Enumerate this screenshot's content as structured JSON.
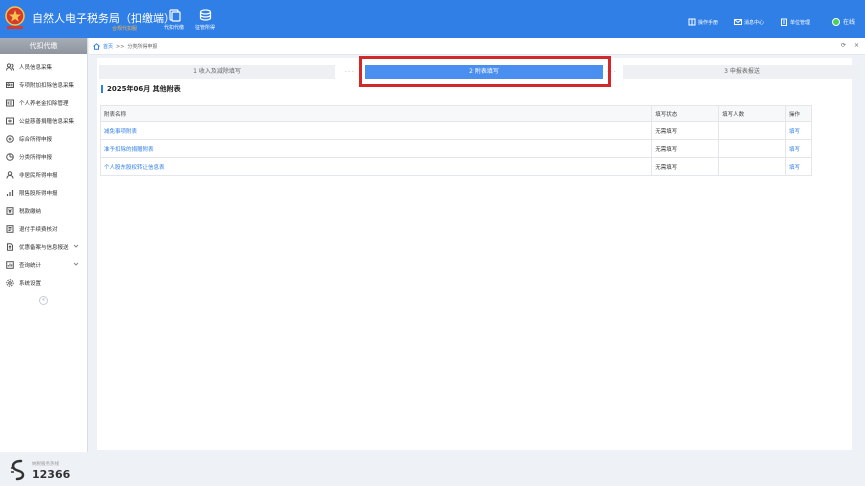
{
  "app": {
    "title": "自然人电子税务局（扣缴端）",
    "subtitle": "合规代扣服",
    "logo": "tax-emblem-logo"
  },
  "top_nav": [
    {
      "label": "代扣代缴",
      "icon": "document-stack-icon"
    },
    {
      "label": "征管所得",
      "icon": "coin-stack-icon"
    }
  ],
  "top_right": {
    "manual": "操作手册",
    "messages": "消息中心",
    "unit_manage": "单位管理",
    "online": "在线"
  },
  "sidebar": {
    "header": "代扣代缴",
    "items": [
      {
        "label": "人员信息采集",
        "icon": "people-icon"
      },
      {
        "label": "专项附加扣除信息采集",
        "icon": "id-card-icon"
      },
      {
        "label": "个人养老金扣除管理",
        "icon": "wallet-icon"
      },
      {
        "label": "公益慈善捐赠信息采集",
        "icon": "donation-icon"
      },
      {
        "label": "综合所得申报",
        "icon": "doc-icon"
      },
      {
        "label": "分类所得申报",
        "icon": "pie-icon"
      },
      {
        "label": "非居民所得申报",
        "icon": "person-icon"
      },
      {
        "label": "限售股所得申报",
        "icon": "bar-chart-icon"
      },
      {
        "label": "税款缴纳",
        "icon": "tax-icon"
      },
      {
        "label": "退付手续费核对",
        "icon": "checklist-icon"
      },
      {
        "label": "优惠备案与信息报送",
        "icon": "file-upload-icon",
        "expandable": true
      },
      {
        "label": "查询统计",
        "icon": "search-stats-icon",
        "expandable": true
      },
      {
        "label": "系统设置",
        "icon": "gear-icon"
      }
    ],
    "collapse_glyph": "«",
    "hotline_label": "纳税服务热线",
    "hotline_number": "12366"
  },
  "breadcrumb": {
    "home": "首页",
    "separator": ">>",
    "current": "分类所得申报"
  },
  "steps": [
    {
      "label": "1 收入及减除填写",
      "active": false
    },
    {
      "label": "2 附表填写",
      "active": true
    },
    {
      "label": "3 申报表报送",
      "active": false
    }
  ],
  "section": {
    "title": "2025年06月  其他附表"
  },
  "table": {
    "headers": [
      "附表名称",
      "填写状态",
      "填写人数",
      "操作"
    ],
    "rows": [
      {
        "name": "减免事项附表",
        "status": "无需填写",
        "count": "",
        "action": "填写"
      },
      {
        "name": "准予扣除的捐赠附表",
        "status": "无需填写",
        "count": "",
        "action": "填写"
      },
      {
        "name": "个人股东股权转让信息表",
        "status": "无需填写",
        "count": "",
        "action": "填写"
      }
    ]
  },
  "colors": {
    "brand_blue": "#2f7fe6",
    "active_step": "#4a8ff0",
    "highlight_red": "#d2282a",
    "online_green": "#47d35a"
  }
}
